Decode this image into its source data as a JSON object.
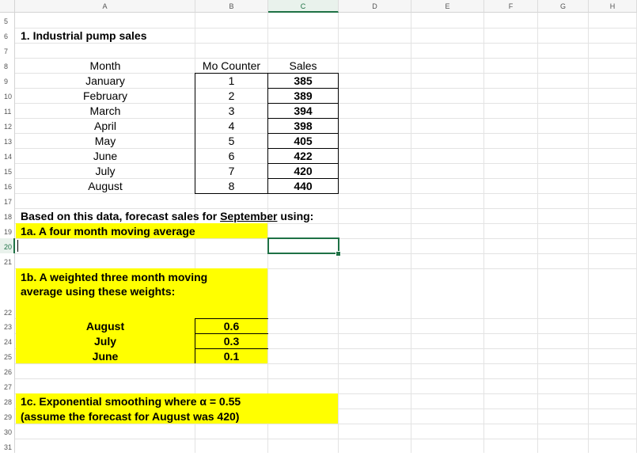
{
  "columns": [
    "A",
    "B",
    "C",
    "D",
    "E",
    "F",
    "G",
    "H"
  ],
  "selected_column": "C",
  "rows": [
    "5",
    "6",
    "7",
    "8",
    "9",
    "10",
    "11",
    "12",
    "13",
    "14",
    "15",
    "16",
    "17",
    "18",
    "19",
    "20",
    "21",
    "22",
    "23",
    "24",
    "25",
    "26",
    "27",
    "28",
    "29",
    "30",
    "31"
  ],
  "selected_row": "20",
  "title": "1. Industrial pump sales",
  "table": {
    "headers": [
      "Month",
      "Mo Counter",
      "Sales"
    ],
    "rows": [
      [
        "January",
        "1",
        "385"
      ],
      [
        "February",
        "2",
        "389"
      ],
      [
        "March",
        "3",
        "394"
      ],
      [
        "April",
        "4",
        "398"
      ],
      [
        "May",
        "5",
        "405"
      ],
      [
        "June",
        "6",
        "422"
      ],
      [
        "July",
        "7",
        "420"
      ],
      [
        "August",
        "8",
        "440"
      ]
    ]
  },
  "instruction_prefix": "Based on this data, forecast sales for ",
  "instruction_month": "September",
  "instruction_suffix": " using:",
  "q1a": "1a.  A four month moving average",
  "q1b_line1": "1b.  A weighted three month moving",
  "q1b_line2": "average using these weights:",
  "weights": [
    {
      "month": "August",
      "weight": "0.6"
    },
    {
      "month": "July",
      "weight": "0.3"
    },
    {
      "month": "June",
      "weight": "0.1"
    }
  ],
  "q1c_line1": "1c. Exponential smoothing where α = 0.55",
  "q1c_line2": "(assume the forecast for August was 420)",
  "colors": {
    "highlight": "#ffff00",
    "selection": "#1e7145"
  }
}
